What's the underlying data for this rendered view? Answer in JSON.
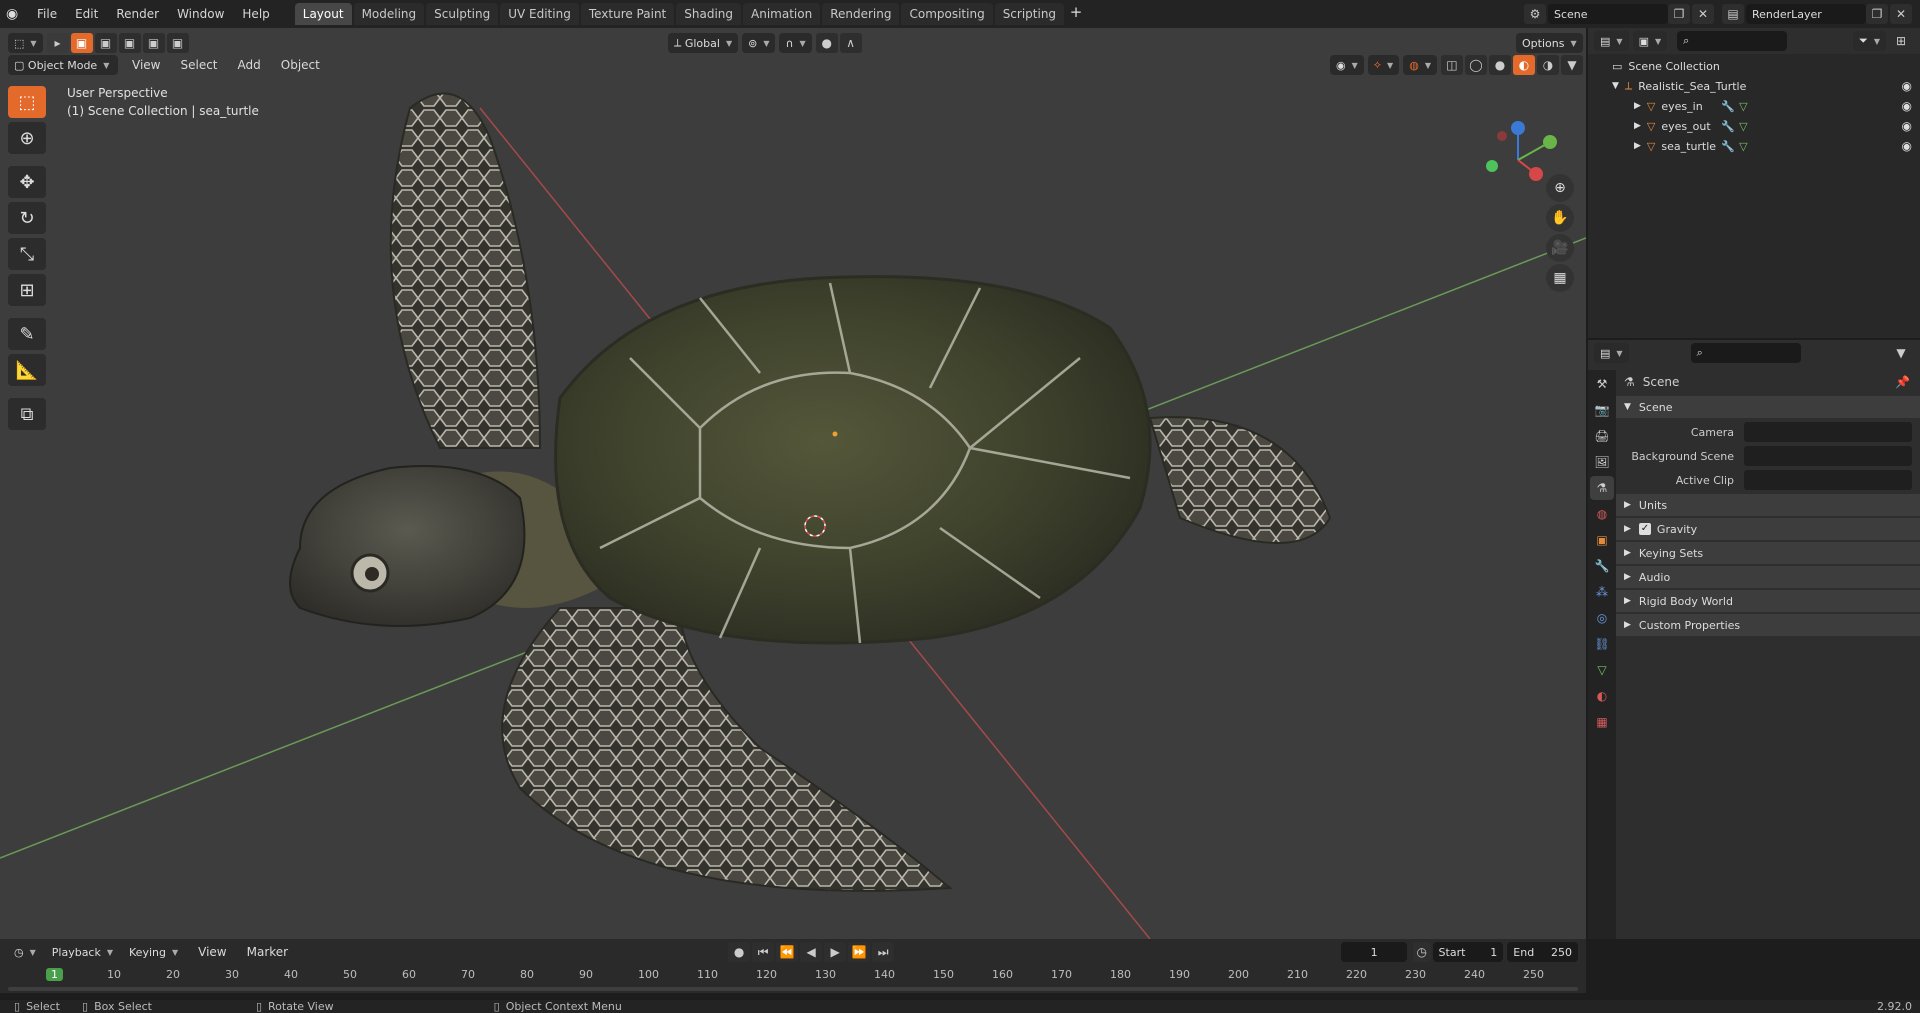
{
  "menus": [
    "File",
    "Edit",
    "Render",
    "Window",
    "Help"
  ],
  "workspaces": [
    "Layout",
    "Modeling",
    "Sculpting",
    "UV Editing",
    "Texture Paint",
    "Shading",
    "Animation",
    "Rendering",
    "Compositing",
    "Scripting"
  ],
  "active_workspace": "Layout",
  "scene_name": "Scene",
  "render_layer": "RenderLayer",
  "viewport": {
    "mode": "Object Mode",
    "menus": [
      "View",
      "Select",
      "Add",
      "Object"
    ],
    "orientation": "Global",
    "options_label": "Options",
    "perspective_label": "User Perspective",
    "collection_label": "(1) Scene Collection | sea_turtle"
  },
  "outliner": {
    "root": "Scene Collection",
    "collection": "Realistic_Sea_Turtle",
    "items": [
      "eyes_in",
      "eyes_out",
      "sea_turtle"
    ]
  },
  "properties": {
    "header": "Scene",
    "panel": "Scene",
    "fields": [
      "Camera",
      "Background Scene",
      "Active Clip"
    ],
    "subpanels": [
      "Units",
      "Gravity",
      "Keying Sets",
      "Audio",
      "Rigid Body World",
      "Custom Properties"
    ]
  },
  "timeline": {
    "menus": [
      "Playback",
      "Keying",
      "View",
      "Marker"
    ],
    "current_frame": "1",
    "start_label": "Start",
    "start": "1",
    "end_label": "End",
    "end": "250",
    "ticks": [
      "1",
      "10",
      "20",
      "30",
      "40",
      "50",
      "60",
      "70",
      "80",
      "90",
      "100",
      "110",
      "120",
      "130",
      "140",
      "150",
      "160",
      "170",
      "180",
      "190",
      "200",
      "210",
      "220",
      "230",
      "240",
      "250"
    ]
  },
  "status": {
    "select": "Select",
    "box_select": "Box Select",
    "rotate_view": "Rotate View",
    "context_menu": "Object Context Menu",
    "version": "2.92.0"
  },
  "colors": {
    "accent": "#e46a2c",
    "active_tab": "#474747",
    "viewport_bg": "#3d3d3d"
  }
}
